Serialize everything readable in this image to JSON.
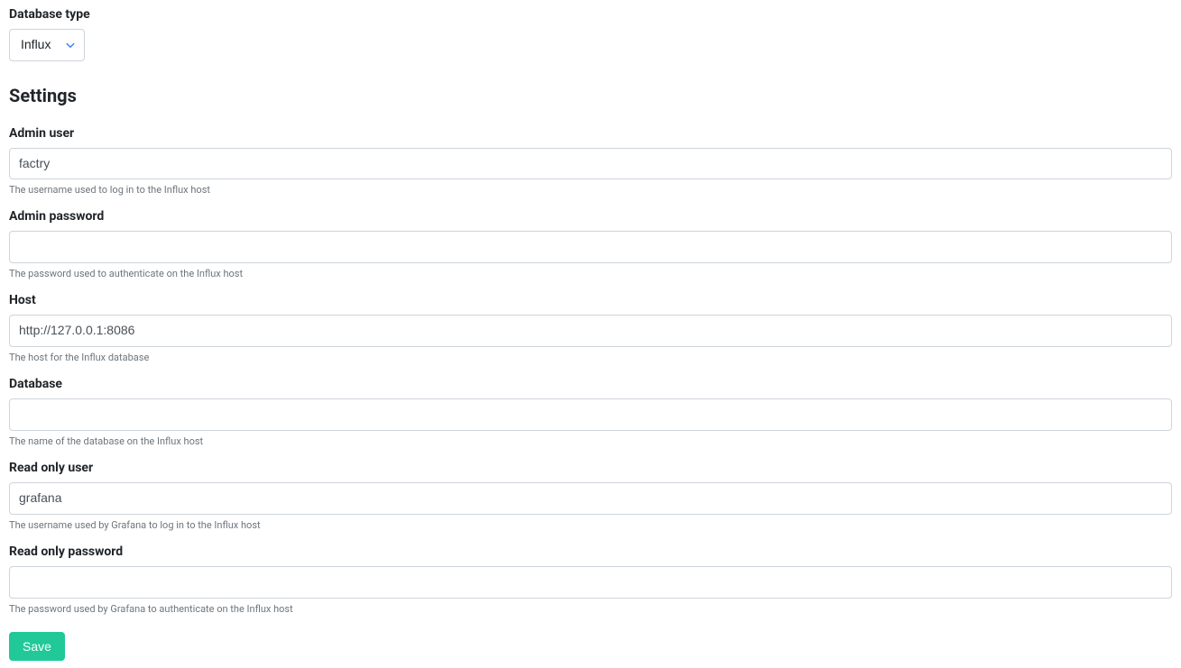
{
  "database_type": {
    "label": "Database type",
    "selected": "Influx"
  },
  "settings_heading": "Settings",
  "fields": {
    "admin_user": {
      "label": "Admin user",
      "value": "factry",
      "help": "The username used to log in to the Influx host"
    },
    "admin_password": {
      "label": "Admin password",
      "value": "",
      "help": "The password used to authenticate on the Influx host"
    },
    "host": {
      "label": "Host",
      "value": "http://127.0.0.1:8086",
      "help": "The host for the Influx database"
    },
    "database": {
      "label": "Database",
      "value": "",
      "help": "The name of the database on the Influx host"
    },
    "read_only_user": {
      "label": "Read only user",
      "value": "grafana",
      "help": "The username used by Grafana to log in to the Influx host"
    },
    "read_only_password": {
      "label": "Read only password",
      "value": "",
      "help": "The password used by Grafana to authenticate on the Influx host"
    }
  },
  "save_label": "Save",
  "colors": {
    "accent": "#20c997",
    "caret": "#3b82f6"
  }
}
